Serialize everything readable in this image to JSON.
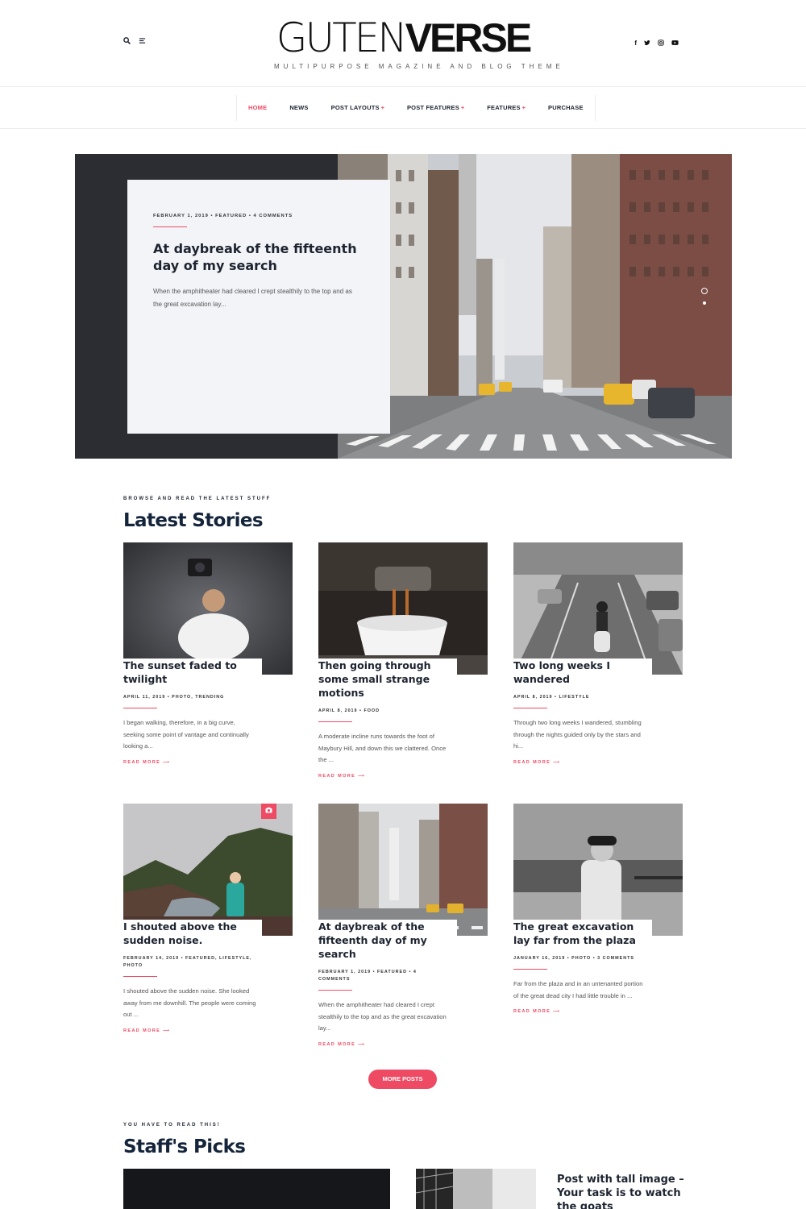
{
  "header": {
    "logo_thin": "GUTEN",
    "logo_bold": "VERSE",
    "tagline": "MULTIPURPOSE MAGAZINE AND BLOG THEME",
    "icons": [
      "search-icon",
      "menu-icon"
    ],
    "social": [
      "f",
      "t",
      "i",
      "y"
    ],
    "social_icons": [
      "facebook-icon",
      "twitter-icon",
      "instagram-icon",
      "youtube-icon"
    ]
  },
  "nav": {
    "items": [
      {
        "label": "HOME",
        "active": true,
        "dropdown": false
      },
      {
        "label": "NEWS",
        "active": false,
        "dropdown": false
      },
      {
        "label": "POST LAYOUTS",
        "active": false,
        "dropdown": true
      },
      {
        "label": "POST FEATURES",
        "active": false,
        "dropdown": true
      },
      {
        "label": "FEATURES",
        "active": false,
        "dropdown": true
      },
      {
        "label": "PURCHASE",
        "active": false,
        "dropdown": false
      }
    ],
    "caret": "+"
  },
  "hero": {
    "meta": "FEBRUARY 1, 2019  •  FEATURED • 4 COMMENTS",
    "title": "At daybreak of the fifteenth day of my search",
    "excerpt": "When the amphitheater had cleared I crept stealthily to the top and as the great excavation lay...",
    "slides": 2,
    "active_slide": 1
  },
  "latest": {
    "kicker": "BROWSE AND READ THE LATEST STUFF",
    "title": "Latest Stories",
    "read_more": "READ MORE  ⟶",
    "posts": [
      {
        "title": "The sunset faded to twilight",
        "meta": "APRIL 11, 2019  •  PHOTO, TRENDING",
        "excerpt": "I began walking, therefore, in a big curve, seeking some point of vantage and continually looking a...",
        "image": "man-lying-camera"
      },
      {
        "title": "Then going through some small strange motions",
        "meta": "APRIL 8, 2019  •  FOOD",
        "excerpt": "A moderate incline runs towards the foot of Maybury Hill, and down this we clattered. Once the ...",
        "image": "espresso-machine"
      },
      {
        "title": "Two long weeks I wandered",
        "meta": "APRIL 8, 2019  •  LIFESTYLE",
        "excerpt": "Through two long weeks I wandered, stumbling through the nights guided only by the stars and hi...",
        "image": "scooter-highway"
      },
      {
        "title": "I shouted above the sudden noise.",
        "meta": "FEBRUARY 14, 2019  •  FEATURED, LIFESTYLE, PHOTO",
        "excerpt": "I shouted above the sudden noise. She looked away from me downhill. The people were coming out ...",
        "image": "mountain-lake",
        "badge": "camera-icon"
      },
      {
        "title": "At daybreak of the fifteenth day of my search",
        "meta": "FEBRUARY 1, 2019  •  FEATURED • 4 COMMENTS",
        "excerpt": "When the amphitheater had cleared I crept stealthily to the top and as the great excavation lay...",
        "image": "city-street"
      },
      {
        "title": "The great excavation lay far from the plaza",
        "meta": "JANUARY 16, 2019  •  PHOTO • 3 COMMENTS",
        "excerpt": "Far from the plaza and in an untenanted portion of the great dead city I had little trouble in ...",
        "image": "woman-harbor"
      }
    ],
    "more_button": "MORE POSTS"
  },
  "picks": {
    "kicker": "YOU HAVE TO READ THIS!",
    "title": "Staff's Picks",
    "side_title": "Post with tall image – Your task is to watch the goats"
  }
}
